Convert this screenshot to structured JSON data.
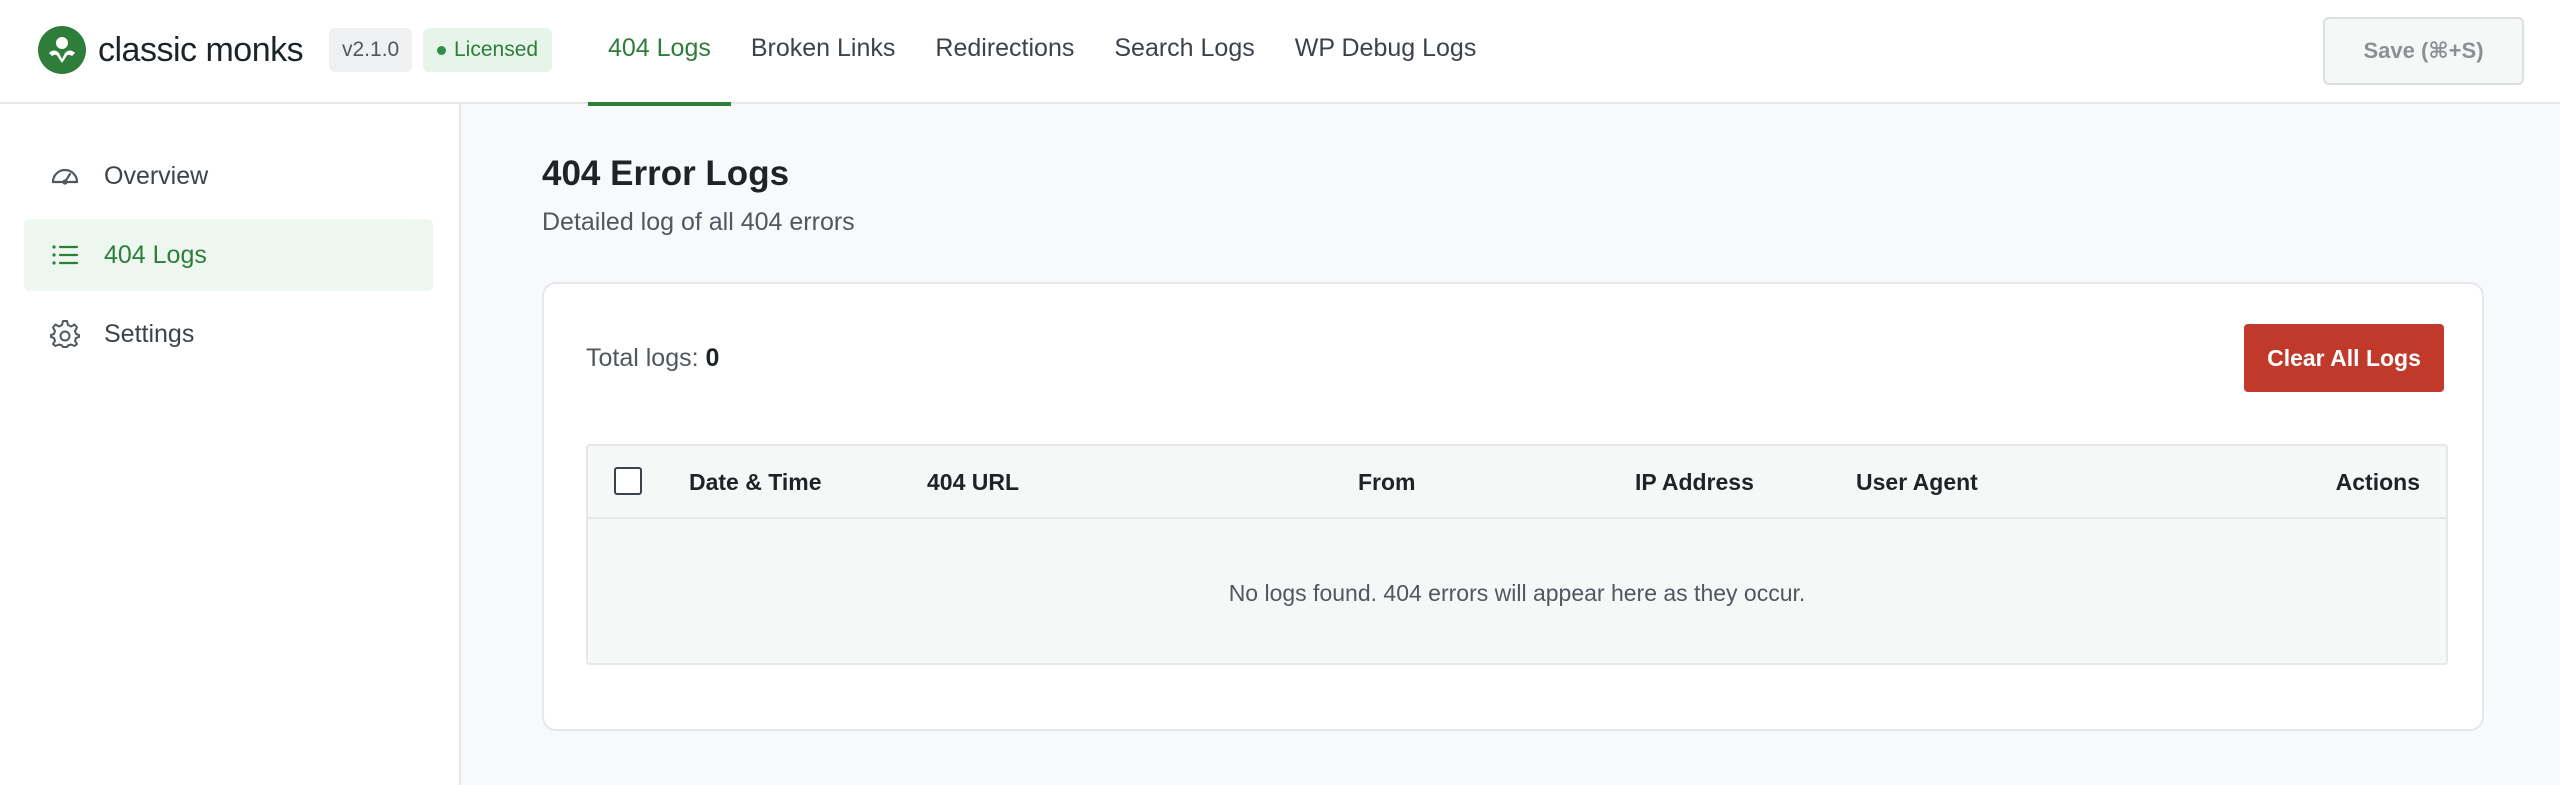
{
  "brand": {
    "name": "classic monks",
    "version": "v2.1.0",
    "license_status": "Licensed"
  },
  "tabs": [
    {
      "label": "404 Logs",
      "active": true
    },
    {
      "label": "Broken Links",
      "active": false
    },
    {
      "label": "Redirections",
      "active": false
    },
    {
      "label": "Search Logs",
      "active": false
    },
    {
      "label": "WP Debug Logs",
      "active": false
    }
  ],
  "toolbar": {
    "save_label": "Save (⌘+S)"
  },
  "sidebar": {
    "items": [
      {
        "label": "Overview",
        "icon": "dashboard-gauge-icon",
        "active": false
      },
      {
        "label": "404 Logs",
        "icon": "list-icon",
        "active": true
      },
      {
        "label": "Settings",
        "icon": "gear-icon",
        "active": false
      }
    ]
  },
  "main": {
    "title": "404 Error Logs",
    "subtitle": "Detailed log of all 404 errors",
    "total_label": "Total logs:",
    "total_count": "0",
    "clear_label": "Clear All Logs",
    "table": {
      "columns": [
        "Date & Time",
        "404 URL",
        "From",
        "IP Address",
        "User Agent",
        "Actions"
      ],
      "rows": [],
      "empty_message": "No logs found. 404 errors will appear here as they occur."
    }
  },
  "colors": {
    "accent": "#2f7d3a",
    "danger": "#c0392b"
  }
}
